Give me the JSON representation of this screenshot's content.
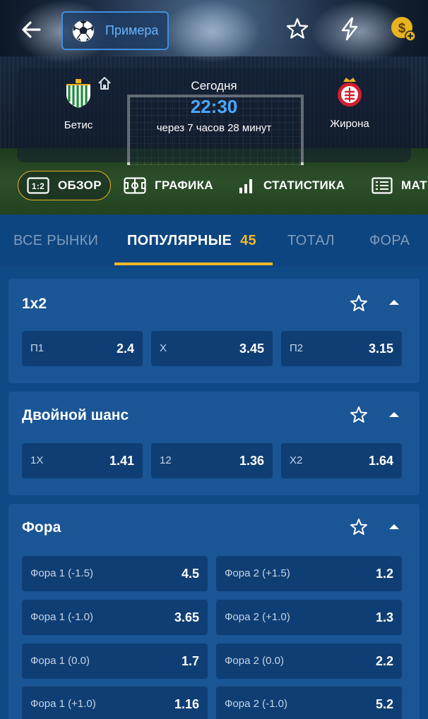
{
  "header": {
    "league_label": "Примера",
    "icons": [
      "back-arrow-icon",
      "soccer-ball-icon",
      "star-icon",
      "lightning-icon",
      "coin-plus-icon"
    ]
  },
  "match": {
    "home_team": "Бетис",
    "away_team": "Жирона",
    "day": "Сегодня",
    "time": "22:30",
    "countdown": "через 7 часов 28 минут"
  },
  "subnav": [
    {
      "label": "ОБЗОР",
      "icon": "score-1-2-icon"
    },
    {
      "label": "ГРАФИКА",
      "icon": "field-icon"
    },
    {
      "label": "СТАТИСТИКА",
      "icon": "bar-chart-icon"
    },
    {
      "label": "МАТ",
      "icon": "list-icon"
    }
  ],
  "tabs": [
    {
      "label": "ВСЕ РЫНКИ"
    },
    {
      "label": "ПОПУЛЯРНЫЕ",
      "count": "45"
    },
    {
      "label": "ТОТАЛ"
    },
    {
      "label": "ФОРА"
    }
  ],
  "markets": [
    {
      "title": "1x2",
      "odds": [
        {
          "label": "П1",
          "value": "2.4"
        },
        {
          "label": "X",
          "value": "3.45"
        },
        {
          "label": "П2",
          "value": "3.15"
        }
      ]
    },
    {
      "title": "Двойной шанс",
      "odds": [
        {
          "label": "1X",
          "value": "1.41"
        },
        {
          "label": "12",
          "value": "1.36"
        },
        {
          "label": "X2",
          "value": "1.64"
        }
      ]
    },
    {
      "title": "Фора",
      "odds": [
        {
          "label": "Фора 1 (-1.5)",
          "value": "4.5"
        },
        {
          "label": "Фора 2 (+1.5)",
          "value": "1.2"
        },
        {
          "label": "Фора 1 (-1.0)",
          "value": "3.65"
        },
        {
          "label": "Фора 2 (+1.0)",
          "value": "1.3"
        },
        {
          "label": "Фора 1 (0.0)",
          "value": "1.7"
        },
        {
          "label": "Фора 2 (0.0)",
          "value": "2.2"
        },
        {
          "label": "Фора 1 (+1.0)",
          "value": "1.16"
        },
        {
          "label": "Фора 2 (-1.0)",
          "value": "5.2"
        }
      ]
    }
  ],
  "colors": {
    "accent": "#f2b829",
    "link": "#4aa8ff",
    "panel": "#1a5596",
    "cell": "#0f3e74"
  }
}
